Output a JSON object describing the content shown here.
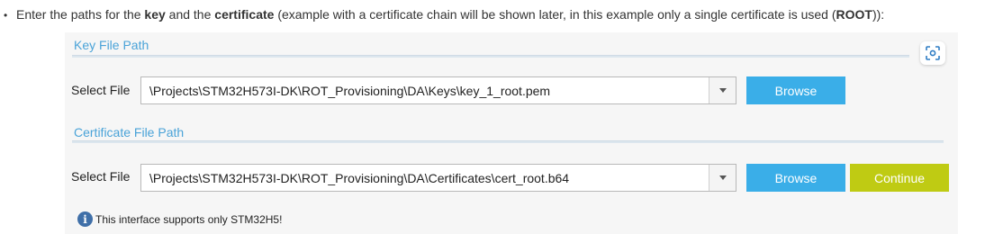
{
  "intro": {
    "t1": "Enter the paths for the ",
    "b1": "key",
    "t2": " and the ",
    "b2": "certificate",
    "t3": " (example with a certificate chain will be shown later, in this example only a single certificate is used (",
    "b3": "ROOT",
    "t4": ")):"
  },
  "key_section": {
    "title": "Key File Path",
    "label": "Select File",
    "value": "\\Projects\\STM32H573I-DK\\ROT_Provisioning\\DA\\Keys\\key_1_root.pem",
    "browse": "Browse"
  },
  "cert_section": {
    "title": "Certificate File Path",
    "label": "Select File",
    "value": "\\Projects\\STM32H573I-DK\\ROT_Provisioning\\DA\\Certificates\\cert_root.b64",
    "browse": "Browse",
    "continue": "Continue"
  },
  "info": {
    "icon": "i",
    "text": "This interface supports only STM32H5!"
  },
  "icons": {
    "scan": "scan-icon",
    "dropdown": "chevron-down-icon",
    "info": "info-icon"
  },
  "colors": {
    "accent": "#3aaee8",
    "continue": "#bfcb13",
    "title": "#4aa3d8"
  }
}
